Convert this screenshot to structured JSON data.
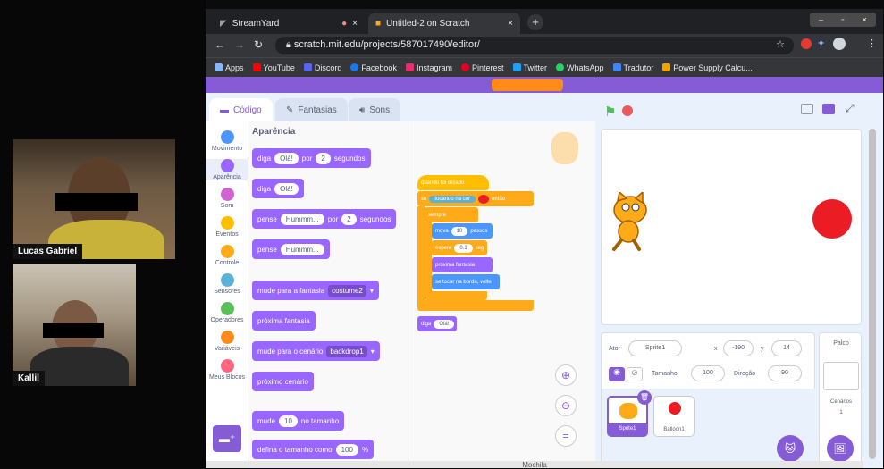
{
  "stream": {
    "participants": [
      {
        "name": "Lucas Gabriel"
      },
      {
        "name": "Kallil"
      }
    ]
  },
  "browser": {
    "tabs": [
      {
        "label": "StreamYard",
        "icon": "streamyard-icon"
      },
      {
        "label": "Untitled-2 on Scratch",
        "icon": "scratch-icon"
      }
    ],
    "url": "scratch.mit.edu/projects/587017490/editor/",
    "bookmarks": [
      {
        "label": "Apps",
        "color": "#5f6368"
      },
      {
        "label": "YouTube",
        "color": "#ff0000"
      },
      {
        "label": "Discord",
        "color": "#5865f2"
      },
      {
        "label": "Facebook",
        "color": "#1877f2"
      },
      {
        "label": "Instagram",
        "color": "#e1306c"
      },
      {
        "label": "Pinterest",
        "color": "#e60023"
      },
      {
        "label": "Twitter",
        "color": "#1da1f2"
      },
      {
        "label": "WhatsApp",
        "color": "#25d366"
      },
      {
        "label": "Tradutor",
        "color": "#4285f4"
      },
      {
        "label": "Power Supply Calcu...",
        "color": "#f4a300"
      }
    ]
  },
  "scratch": {
    "tabs": {
      "code": "Código",
      "costumes": "Fantasias",
      "sounds": "Sons"
    },
    "categories": [
      {
        "label": "Movimento",
        "color": "#4c97ff"
      },
      {
        "label": "Aparência",
        "color": "#9966ff"
      },
      {
        "label": "Som",
        "color": "#cf63cf"
      },
      {
        "label": "Eventos",
        "color": "#ffbf00"
      },
      {
        "label": "Controle",
        "color": "#ffab19"
      },
      {
        "label": "Sensores",
        "color": "#5cb1d6"
      },
      {
        "label": "Operadores",
        "color": "#59c059"
      },
      {
        "label": "Variáveis",
        "color": "#ff8c1a"
      },
      {
        "label": "Meus Blocos",
        "color": "#ff6680"
      }
    ],
    "palette_title": "Aparência",
    "blocks": {
      "b1": {
        "a": "diga",
        "p1": "Olá!",
        "b": "por",
        "p2": "2",
        "c": "segundos"
      },
      "b2": {
        "a": "diga",
        "p1": "Olá!"
      },
      "b3": {
        "a": "pense",
        "p1": "Hummm...",
        "b": "por",
        "p2": "2",
        "c": "segundos"
      },
      "b4": {
        "a": "pense",
        "p1": "Hummm..."
      },
      "b5": {
        "a": "mude para a fantasia",
        "p1": "costume2"
      },
      "b6": {
        "a": "próxima fantasia"
      },
      "b7": {
        "a": "mude para o cenário",
        "p1": "backdrop1"
      },
      "b8": {
        "a": "próximo cenário"
      },
      "b9": {
        "a": "mude",
        "p1": "10",
        "b": "no tamanho"
      },
      "b10": {
        "a": "defina o tamanho como",
        "p1": "100",
        "b": "%"
      }
    },
    "script": {
      "hat": "quando  foi clicado",
      "if_label": "se",
      "if_cond": "tocando na cor",
      "if_then": "então",
      "forever": "sempre",
      "move": "mova",
      "move_val": "10",
      "move_unit": "passos",
      "wait": "espere",
      "wait_val": "0.1",
      "wait_unit": "seg",
      "next_costume": "próxima fantasia",
      "bounce": "se tocar na borda, volte",
      "say": "diga",
      "say_val": "Olá!"
    },
    "sprite_info": {
      "actor_label": "Ator",
      "actor_value": "Sprite1",
      "x_label": "x",
      "x_value": "-190",
      "y_label": "y",
      "y_value": "14",
      "size_label": "Tamanho",
      "size_value": "100",
      "dir_label": "Direção",
      "dir_value": "90"
    },
    "sprites": [
      {
        "name": "Sprite1"
      },
      {
        "name": "Balloon1"
      }
    ],
    "stage_panel": {
      "title": "Palco",
      "backdrops_label": "Cenários",
      "backdrops_count": "1"
    },
    "backpack": "Mochila"
  }
}
